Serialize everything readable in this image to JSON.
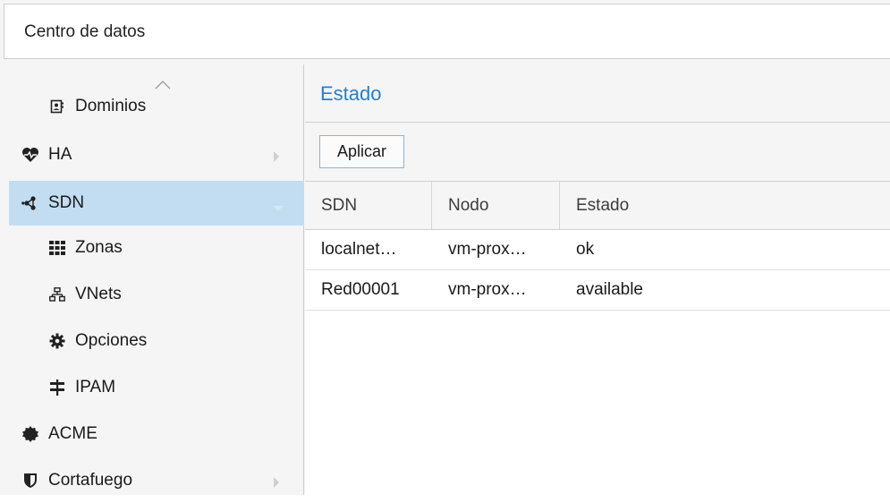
{
  "header": {
    "title": "Centro de datos"
  },
  "sidebar": {
    "items": [
      {
        "label": "Dominios",
        "icon": "address-book-icon",
        "indent": true
      },
      {
        "label": "HA",
        "icon": "heartbeat-icon",
        "indent": false,
        "arrow": "right"
      },
      {
        "label": "SDN",
        "icon": "network-nodes-icon",
        "indent": false,
        "arrow": "down",
        "selected": true
      },
      {
        "label": "Zonas",
        "icon": "grid-icon",
        "indent": true
      },
      {
        "label": "VNets",
        "icon": "sitemap-icon",
        "indent": true
      },
      {
        "label": "Opciones",
        "icon": "gear-icon",
        "indent": true
      },
      {
        "label": "IPAM",
        "icon": "signpost-icon",
        "indent": true
      },
      {
        "label": "ACME",
        "icon": "certificate-icon",
        "indent": false
      },
      {
        "label": "Cortafuego",
        "icon": "shield-icon",
        "indent": false,
        "arrow": "right"
      }
    ]
  },
  "panel": {
    "title": "Estado",
    "apply_label": "Aplicar",
    "columns": [
      "SDN",
      "Nodo",
      "Estado"
    ],
    "rows": [
      {
        "sdn": "localnet…",
        "nodo": "vm-prox…",
        "estado": "ok"
      },
      {
        "sdn": "Red00001",
        "nodo": "vm-prox…",
        "estado": "available"
      }
    ]
  },
  "colors": {
    "accent": "#2a7fc6",
    "selected_bg": "#c2ddf2"
  }
}
